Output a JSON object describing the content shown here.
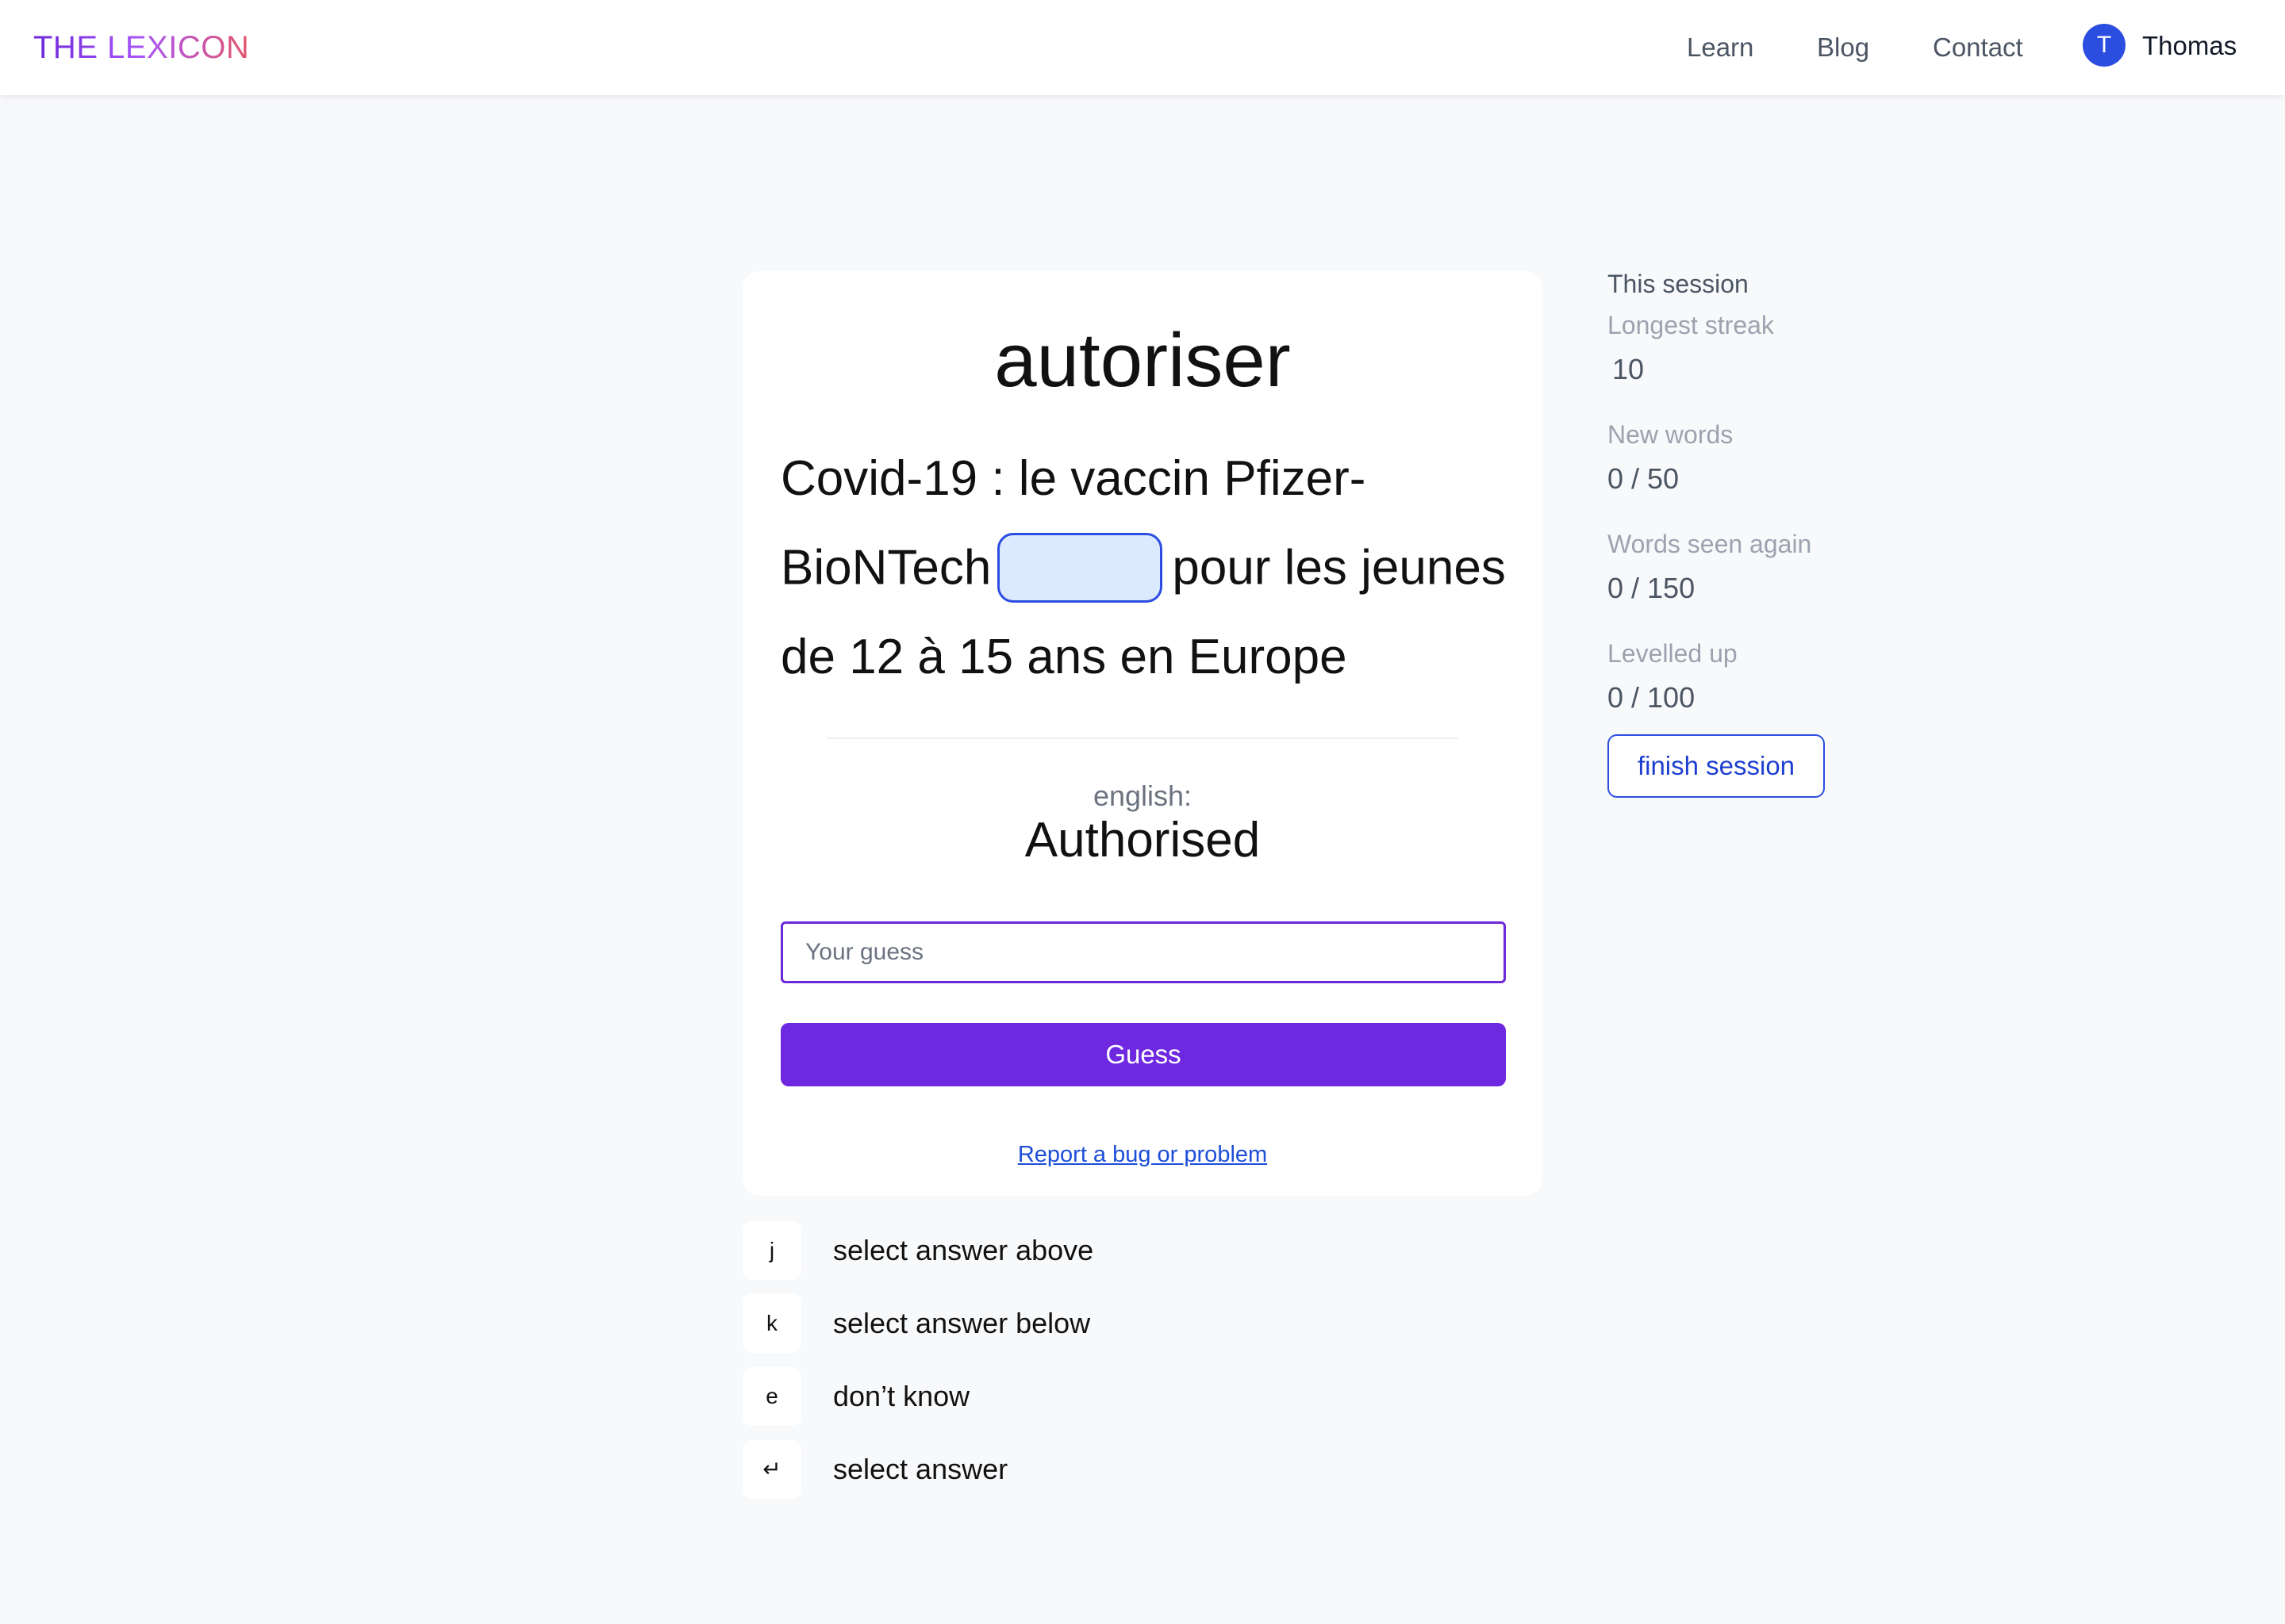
{
  "header": {
    "logo": "THE LEXICON",
    "nav": [
      "Learn",
      "Blog",
      "Contact"
    ],
    "user": {
      "initial": "T",
      "name": "Thomas"
    }
  },
  "card": {
    "word": "autoriser",
    "sentence": {
      "line1": "Covid-19 : le vaccin Pfizer-",
      "line2_before": "BioNTech",
      "line2_after": "pour les jeunes",
      "line3": "de 12 à 15 ans en Europe"
    },
    "translation_label": "english:",
    "translation": "Authorised",
    "input_placeholder": "Your guess",
    "input_value": "",
    "guess_button": "Guess",
    "report_link": "Report a bug or problem"
  },
  "shortcuts": [
    {
      "key": "j",
      "label": "select answer above"
    },
    {
      "key": "k",
      "label": "select answer below"
    },
    {
      "key": "e",
      "label": "don’t know"
    },
    {
      "key": "↵",
      "label": "select answer"
    }
  ],
  "session": {
    "title": "This session",
    "stats": [
      {
        "label": "Longest streak",
        "value": "10"
      },
      {
        "label": "New words",
        "value": "0 / 50"
      },
      {
        "label": "Words seen again",
        "value": "0 / 150"
      },
      {
        "label": "Levelled up",
        "value": "0 / 100"
      }
    ],
    "finish_button": "finish session"
  },
  "colors": {
    "brand_gradient": [
      "#6d28d9",
      "#a855f7",
      "#e5566c"
    ],
    "primary": "#6d28e0",
    "accent_blue": "#2b4ee0",
    "blank_fill": "#dbeafe",
    "background": "#f8f9fb"
  }
}
